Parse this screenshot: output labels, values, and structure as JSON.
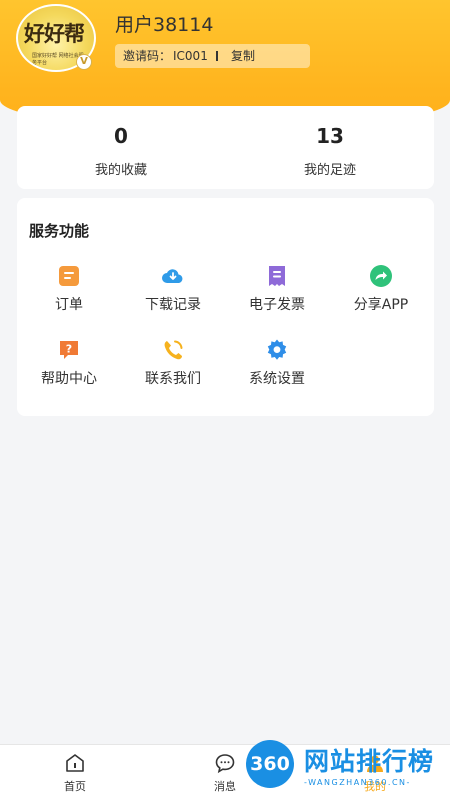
{
  "profile": {
    "avatar_logo": "好好帮",
    "avatar_subtext": "国家好好帮 网络社会服务平台",
    "vip_badge": "V",
    "username": "用户38114",
    "invite_label": "邀请码：",
    "invite_code": "IC001",
    "copy_label": "复制"
  },
  "stats": [
    {
      "value": "0",
      "label": "我的收藏"
    },
    {
      "value": "13",
      "label": "我的足迹"
    }
  ],
  "services": {
    "title": "服务功能",
    "items": [
      {
        "label": "订单",
        "icon": "order-icon",
        "color": "#f59a3c"
      },
      {
        "label": "下载记录",
        "icon": "cloud-download-icon",
        "color": "#2f9be8"
      },
      {
        "label": "电子发票",
        "icon": "invoice-icon",
        "color": "#8e6ad8"
      },
      {
        "label": "分享APP",
        "icon": "share-icon",
        "color": "#2fc27a"
      },
      {
        "label": "帮助中心",
        "icon": "help-icon",
        "color": "#f07a35"
      },
      {
        "label": "联系我们",
        "icon": "phone-icon",
        "color": "#f6b21e"
      },
      {
        "label": "系统设置",
        "icon": "settings-icon",
        "color": "#2f8ee8"
      }
    ]
  },
  "tabbar": {
    "items": [
      {
        "label": "首页",
        "icon": "home-icon"
      },
      {
        "label": "消息",
        "icon": "message-icon"
      },
      {
        "label": "我的",
        "icon": "profile-icon",
        "active": true
      }
    ]
  },
  "watermark": {
    "badge": "360",
    "text": "网站排行榜",
    "sub": "-WANGZHAN360.CN-"
  },
  "colors": {
    "header": "#ffb81f",
    "accent": "#f7a91a"
  }
}
